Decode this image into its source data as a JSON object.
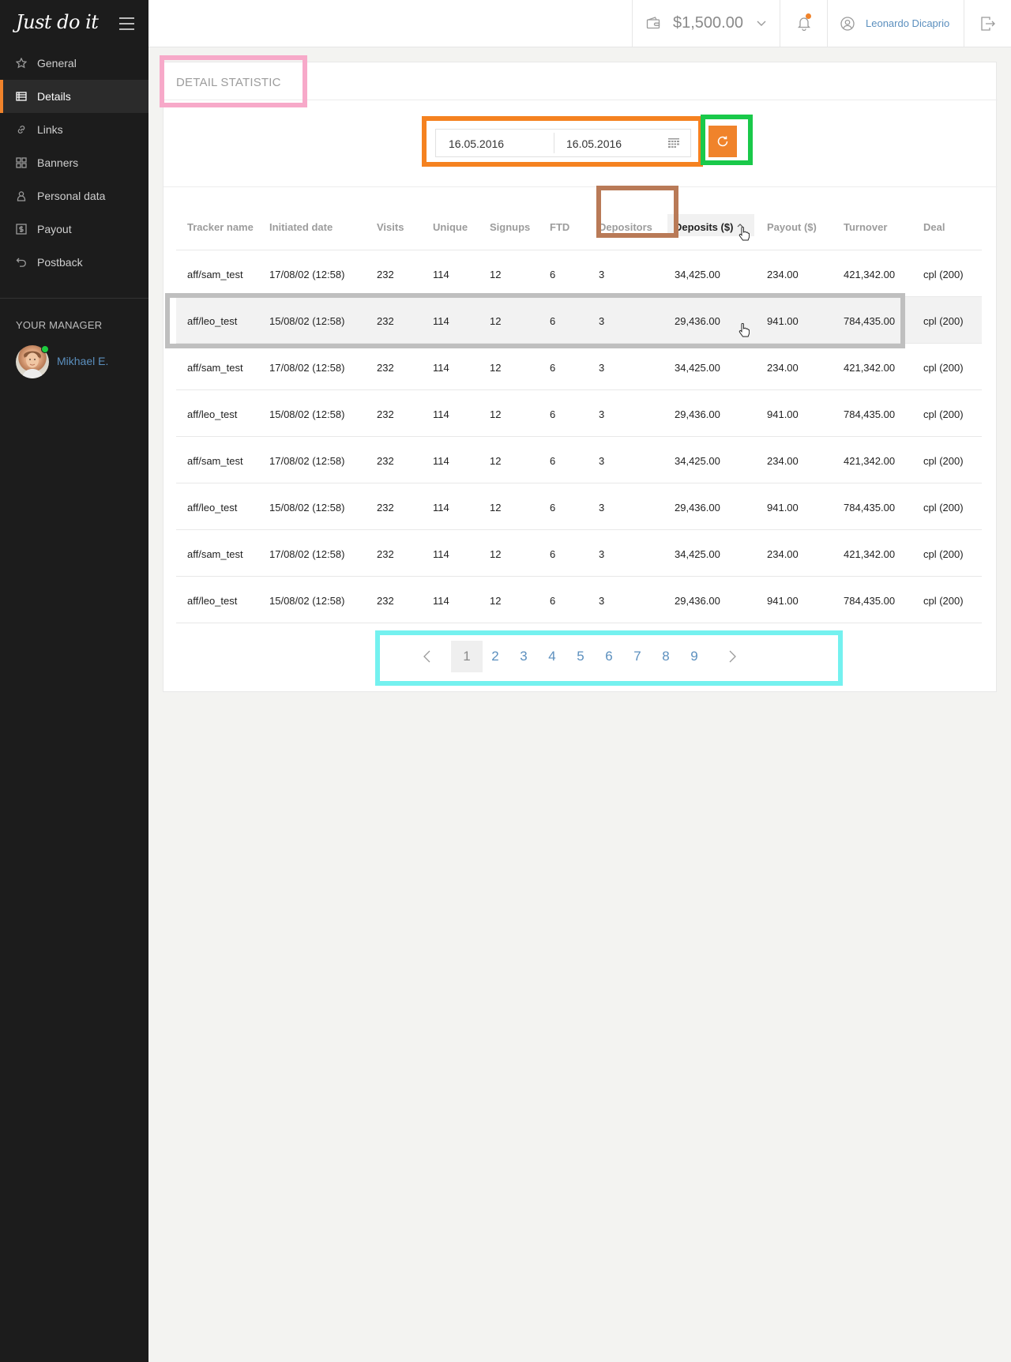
{
  "app": {
    "logo": "Just do it"
  },
  "sidebar": {
    "items": [
      {
        "label": "General",
        "icon": "star-icon"
      },
      {
        "label": "Details",
        "icon": "table-icon",
        "active": true
      },
      {
        "label": "Links",
        "icon": "link-icon"
      },
      {
        "label": "Banners",
        "icon": "grid-icon"
      },
      {
        "label": "Personal data",
        "icon": "person-icon"
      },
      {
        "label": "Payout",
        "icon": "dollar-icon"
      },
      {
        "label": "Postback",
        "icon": "undo-icon"
      }
    ],
    "manager_title": "YOUR MANAGER",
    "manager_name": "Mikhael E."
  },
  "header": {
    "balance": "$1,500.00",
    "user_name": "Leonardo Dicaprio"
  },
  "page": {
    "title": "DETAIL STATISTIC"
  },
  "filter": {
    "date_from": "16.05.2016",
    "date_to": "16.05.2016"
  },
  "table": {
    "columns": [
      "Tracker name",
      "Initiated date",
      "Visits",
      "Unique",
      "Signups",
      "FTD",
      "Depositors",
      "Deposits ($)",
      "Payout ($)",
      "Turnover",
      "Deal"
    ],
    "sorted_column": "Deposits ($)",
    "rows": [
      [
        "aff/sam_test",
        "17/08/02 (12:58)",
        "232",
        "114",
        "12",
        "6",
        "3",
        "34,425.00",
        "234.00",
        "421,342.00",
        "cpl (200)"
      ],
      [
        "aff/leo_test",
        "15/08/02 (12:58)",
        "232",
        "114",
        "12",
        "6",
        "3",
        "29,436.00",
        "941.00",
        "784,435.00",
        "cpl (200)"
      ],
      [
        "aff/sam_test",
        "17/08/02 (12:58)",
        "232",
        "114",
        "12",
        "6",
        "3",
        "34,425.00",
        "234.00",
        "421,342.00",
        "cpl (200)"
      ],
      [
        "aff/leo_test",
        "15/08/02 (12:58)",
        "232",
        "114",
        "12",
        "6",
        "3",
        "29,436.00",
        "941.00",
        "784,435.00",
        "cpl (200)"
      ],
      [
        "aff/sam_test",
        "17/08/02 (12:58)",
        "232",
        "114",
        "12",
        "6",
        "3",
        "34,425.00",
        "234.00",
        "421,342.00",
        "cpl (200)"
      ],
      [
        "aff/leo_test",
        "15/08/02 (12:58)",
        "232",
        "114",
        "12",
        "6",
        "3",
        "29,436.00",
        "941.00",
        "784,435.00",
        "cpl (200)"
      ],
      [
        "aff/sam_test",
        "17/08/02 (12:58)",
        "232",
        "114",
        "12",
        "6",
        "3",
        "34,425.00",
        "234.00",
        "421,342.00",
        "cpl (200)"
      ],
      [
        "aff/leo_test",
        "15/08/02 (12:58)",
        "232",
        "114",
        "12",
        "6",
        "3",
        "29,436.00",
        "941.00",
        "784,435.00",
        "cpl (200)"
      ]
    ]
  },
  "pagination": {
    "pages": [
      "1",
      "2",
      "3",
      "4",
      "5",
      "6",
      "7",
      "8",
      "9"
    ],
    "current": "1"
  },
  "colors": {
    "accent": "#f0832b",
    "link": "#5b8fbe",
    "sidebar_bg": "#1c1c1c",
    "online": "#1dcc3f"
  }
}
